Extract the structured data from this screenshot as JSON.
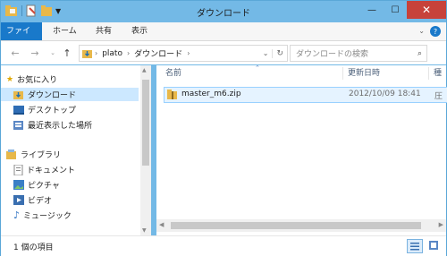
{
  "window": {
    "title": "ダウンロード",
    "minimize": "—",
    "maximize": "☐",
    "close": "✕"
  },
  "ribbon": {
    "tabs": [
      "ファイル",
      "ホーム",
      "共有",
      "表示"
    ],
    "help_icon": "?"
  },
  "address_bar": {
    "crumbs": [
      "plato",
      "ダウンロード"
    ],
    "search_placeholder": "ダウンロードの検索"
  },
  "nav_pane": {
    "favorites_label": "お気に入り",
    "favorites": [
      "ダウンロード",
      "デスクトップ",
      "最近表示した場所"
    ],
    "libraries_label": "ライブラリ",
    "libraries": [
      "ドキュメント",
      "ピクチャ",
      "ビデオ",
      "ミュージック"
    ]
  },
  "columns": {
    "name": "名前",
    "modified": "更新日時",
    "type": "種"
  },
  "files": [
    {
      "name": "master_m6.zip",
      "modified": "2012/10/09 18:41",
      "type": "圧"
    }
  ],
  "status": {
    "count": "1 個の項目"
  },
  "colors": {
    "title_bar": "#73b9e6",
    "file_tab": "#1979ca",
    "close_button": "#c7423a",
    "selection": "#cce8ff"
  }
}
